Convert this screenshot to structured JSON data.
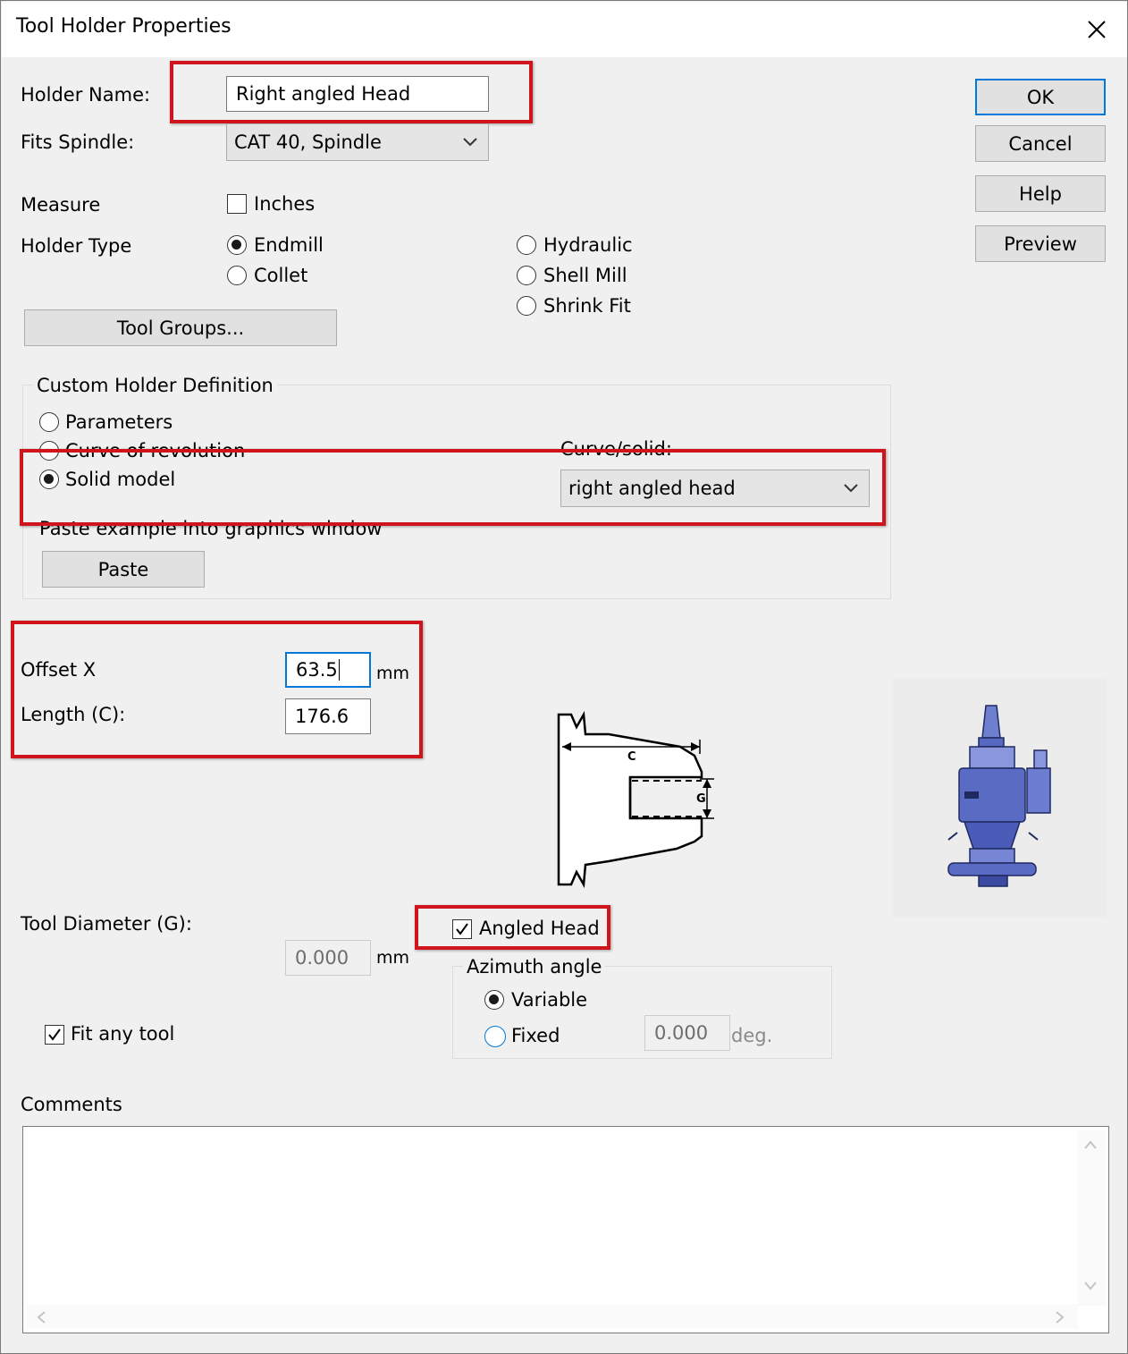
{
  "window": {
    "title": "Tool Holder Properties"
  },
  "fields": {
    "holder_name_label": "Holder Name:",
    "holder_name_value": "Right angled Head",
    "fits_spindle_label": "Fits Spindle:",
    "fits_spindle_value": "CAT 40, Spindle",
    "measure_label": "Measure",
    "inches_label": "Inches",
    "holder_type_label": "Holder Type"
  },
  "holder_types": {
    "endmill": "Endmill",
    "collet": "Collet",
    "hydraulic": "Hydraulic",
    "shell_mill": "Shell Mill",
    "shrink_fit": "Shrink Fit",
    "selected": "Endmill"
  },
  "buttons": {
    "ok": "OK",
    "cancel": "Cancel",
    "help": "Help",
    "preview": "Preview",
    "tool_groups": "Tool Groups...",
    "paste": "Paste"
  },
  "custom_holder": {
    "group_label": "Custom Holder Definition",
    "parameters": "Parameters",
    "curve_of_revolution": "Curve of revolution",
    "solid_model": "Solid model",
    "selected": "Solid model",
    "curve_solid_label": "Curve/solid:",
    "curve_solid_value": "right angled head",
    "paste_hint": "Paste example into graphics window"
  },
  "dimensions": {
    "offset_x_label": "Offset X",
    "offset_x_value": "63.5",
    "offset_x_unit": "mm",
    "length_label": "Length (C):",
    "length_value": "176.6",
    "tool_diameter_label": "Tool Diameter (G):",
    "tool_diameter_value": "0.000",
    "tool_diameter_unit": "mm"
  },
  "diagram": {
    "c_label": "C",
    "g_label": "G"
  },
  "angled_head": {
    "label": "Angled Head",
    "checked": true
  },
  "azimuth": {
    "group_label": "Azimuth angle",
    "variable": "Variable",
    "fixed": "Fixed",
    "selected": "Variable",
    "fixed_value": "0.000",
    "fixed_unit": "deg."
  },
  "fit_any_tool": {
    "label": "Fit any tool",
    "checked": true
  },
  "comments": {
    "label": "Comments",
    "value": ""
  },
  "colors": {
    "highlight": "#d0141c",
    "accent": "#0078d7",
    "face": "#f0f0f0"
  }
}
